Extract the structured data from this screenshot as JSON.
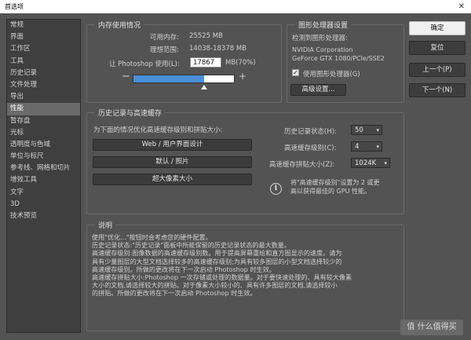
{
  "window": {
    "title": "首选项"
  },
  "sidebar": {
    "items": [
      {
        "label": "常规"
      },
      {
        "label": "界面"
      },
      {
        "label": "工作区"
      },
      {
        "label": "工具"
      },
      {
        "label": "历史记录"
      },
      {
        "label": "文件处理"
      },
      {
        "label": "导出"
      },
      {
        "label": "性能",
        "active": true
      },
      {
        "label": "暂存盘"
      },
      {
        "label": "光标"
      },
      {
        "label": "透明度与色域"
      },
      {
        "label": "单位与标尺"
      },
      {
        "label": "参考线、网格和切片"
      },
      {
        "label": "增效工具"
      },
      {
        "label": "文字"
      },
      {
        "label": "3D"
      },
      {
        "label": "技术预览"
      }
    ]
  },
  "memory": {
    "title": "内存使用情况",
    "available_label": "可用内存:",
    "available_value": "25525 MB",
    "ideal_label": "理想范围:",
    "ideal_value": "14038-18378 MB",
    "usage_label": "让 Photoshop 使用(L):",
    "usage_value": "17867",
    "usage_unit": "MB(70%)",
    "minus": "−",
    "plus": "+",
    "usage_percent": 70
  },
  "gpu": {
    "title": "图形处理器设置",
    "detected_label": "检测到图形处理器:",
    "vendor": "NVIDIA Corporation",
    "model": "GeForce GTX 1080/PCIe/SSE2",
    "use_gpu_label": "使用图形处理器(G)",
    "use_gpu_checked": "✓",
    "advanced_button": "高级设置..."
  },
  "history": {
    "title": "历史记录与高速缓存",
    "prompt": "为下面的情况优化高速缓存级别和拼贴大小:",
    "preset_web": "Web / 用户界面设计",
    "preset_photo": "默认 / 照片",
    "preset_huge": "超大像素大小",
    "states_label": "历史记录状态(H):",
    "states_value": "50",
    "cache_levels_label": "高速缓存级别(C):",
    "cache_levels_value": "4",
    "tile_size_label": "高速缓存拼贴大小(Z):",
    "tile_size_value": "1024K",
    "tip_line1": "将\"高速缓存级别\"设置为 2 或更",
    "tip_line2": "高以获得最佳的 GPU 性能。"
  },
  "description": {
    "title": "说明",
    "lines": [
      "使用\"优化...\"按钮时会考虑您的硬件配置。",
      "历史记录状态:\"历史记录\"面板中所能保留的历史记录状态的最大数量。",
      "高速缓存级别:图像数据的高速缓存级别数。用于提高屏幕重绘和直方图显示的速度。请为",
      "具有少量图层的大型文档选择较多的高速缓存级别;为具有较多图层的小型文档选择较少的",
      "高速缓存级别。所做的更改将在下一次启动 Photoshop 时生效。",
      "高速缓存拼贴大小:Photoshop 一次存储或处理的数据量。对于要快速处理的、具有较大像素",
      "大小的文档,请选择较大的拼贴。对于像素大小较小的、具有许多图层的文档,请选择较小",
      "的拼贴。所做的更改将在下一次启动 Photoshop 时生效。"
    ]
  },
  "actions": {
    "ok": "确定",
    "reset": "复位",
    "prev": "上一个(P)",
    "next": "下一个(N)"
  },
  "watermark": {
    "text": "值 什么值得买"
  }
}
